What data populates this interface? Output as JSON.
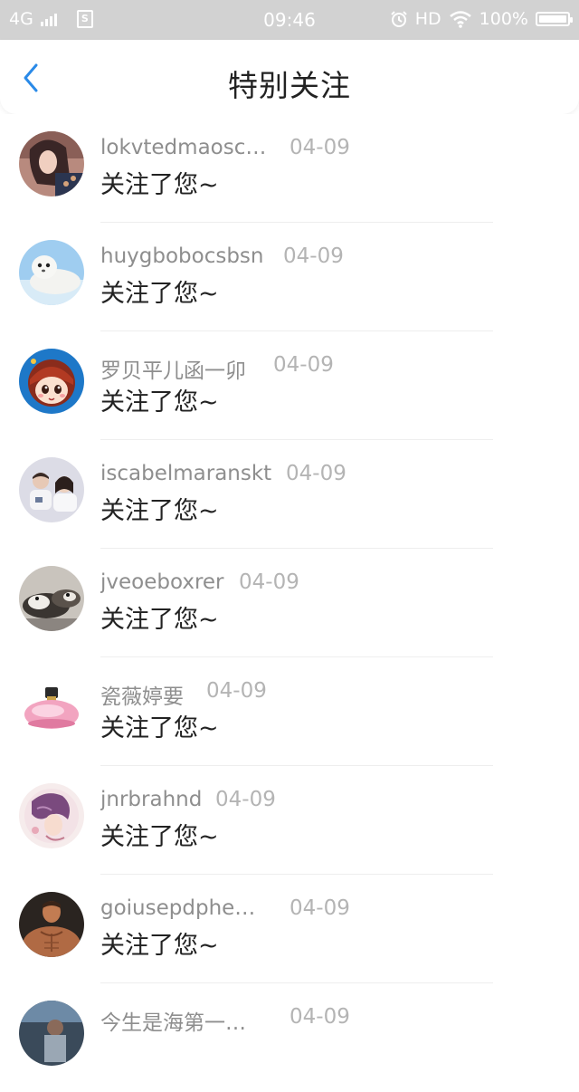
{
  "status_bar": {
    "network": "4G",
    "time": "09:46",
    "hd": "HD",
    "battery": "100%",
    "battery_level": 1.0,
    "sim_label": "S"
  },
  "header": {
    "title": "特别关注",
    "back_icon": "chevron-left-icon",
    "accent_color": "#2a8ae8"
  },
  "notifications": [
    {
      "username": "lokvtedmaosc…",
      "date": "04-09",
      "message": "关注了您~",
      "avatar": "girl-photo"
    },
    {
      "username": "huygbobocsbsn",
      "date": "04-09",
      "message": "关注了您~",
      "avatar": "seal-photo"
    },
    {
      "username": "罗贝平儿函一卯",
      "date": "04-09",
      "message": "关注了您~",
      "avatar": "cartoon-girl"
    },
    {
      "username": "iscabelmaranskt",
      "date": "04-09",
      "message": "关注了您~",
      "avatar": "couple-photo"
    },
    {
      "username": "jveoeboxrer",
      "date": "04-09",
      "message": "关注了您~",
      "avatar": "dogs-photo"
    },
    {
      "username": "瓷薇婷要",
      "date": "04-09",
      "message": "关注了您~",
      "avatar": "perfume-photo"
    },
    {
      "username": "jnrbrahnd",
      "date": "04-09",
      "message": "关注了您~",
      "avatar": "anime-drawing"
    },
    {
      "username": "goiusepdphe…",
      "date": "04-09",
      "message": "关注了您~",
      "avatar": "muscle-man-photo"
    },
    {
      "username": "今生是海第一…",
      "date": "04-09",
      "message": "",
      "avatar": "dark-photo"
    }
  ]
}
